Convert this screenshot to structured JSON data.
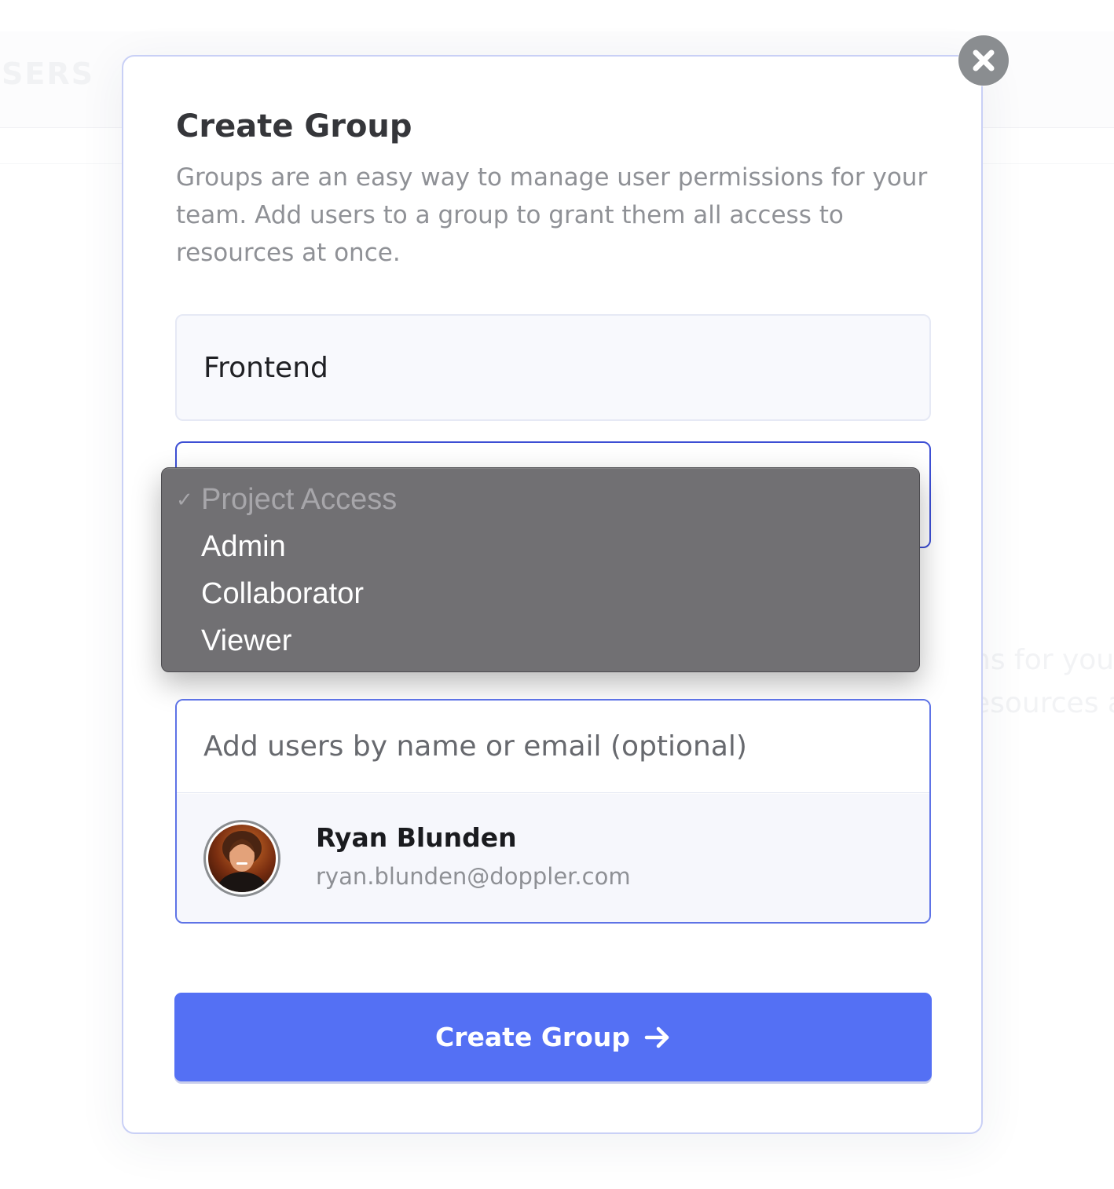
{
  "background": {
    "title": "SERS",
    "text_line_1": "ns for you",
    "text_line_2": "esources a"
  },
  "modal": {
    "close_icon": "close-icon",
    "title": "Create Group",
    "description": "Groups are an easy way to manage user permissions for your team. Add users to a group to grant them all access to resources at once.",
    "group_name": {
      "value": "Frontend"
    },
    "access_select": {
      "options": [
        {
          "label": "Project Access",
          "selected": true,
          "disabled": true
        },
        {
          "label": "Admin",
          "selected": false,
          "disabled": false
        },
        {
          "label": "Collaborator",
          "selected": false,
          "disabled": false
        },
        {
          "label": "Viewer",
          "selected": false,
          "disabled": false
        }
      ],
      "check_glyph": "✓"
    },
    "users": {
      "placeholder": "Add users by name or email (optional)",
      "results": [
        {
          "name": "Ryan Blunden",
          "email": "ryan.blunden@doppler.com",
          "avatar_icon": "avatar-photo"
        }
      ]
    },
    "submit": {
      "label": "Create Group",
      "icon": "arrow-right-icon"
    }
  },
  "colors": {
    "accent": "#5470f4",
    "focus_border": "#3d4fd4",
    "dropdown_bg": "#717073",
    "close_bg": "#8a8d90"
  }
}
